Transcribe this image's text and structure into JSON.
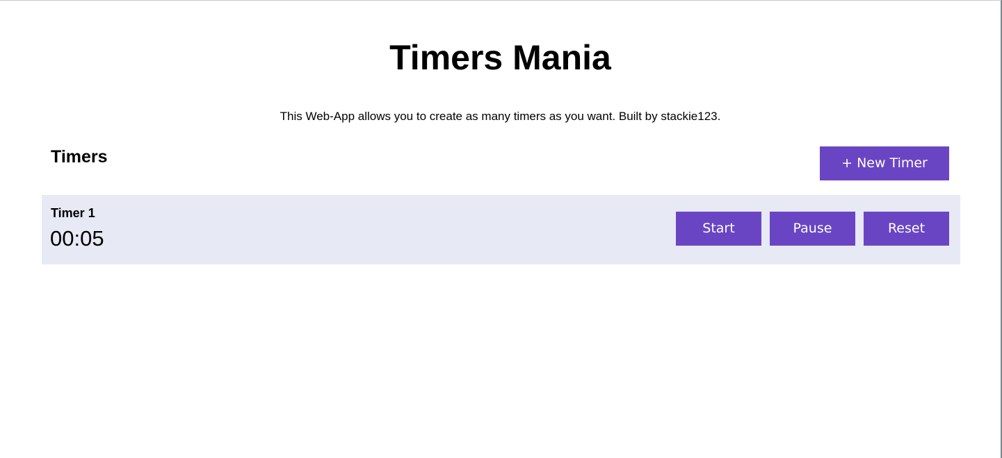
{
  "header": {
    "title": "Timers Mania",
    "description": "This Web-App allows you to create as many timers as you want. Built by stackie123."
  },
  "timers_section": {
    "title": "Timers",
    "new_timer_label": "+ New Timer"
  },
  "timers": [
    {
      "name": "Timer 1",
      "time": "00:05",
      "start_label": "Start",
      "pause_label": "Pause",
      "reset_label": "Reset"
    }
  ],
  "colors": {
    "accent": "#6a45c3",
    "timer_row_bg": "#e7e9f5",
    "text": "#000000",
    "background": "#ffffff"
  }
}
